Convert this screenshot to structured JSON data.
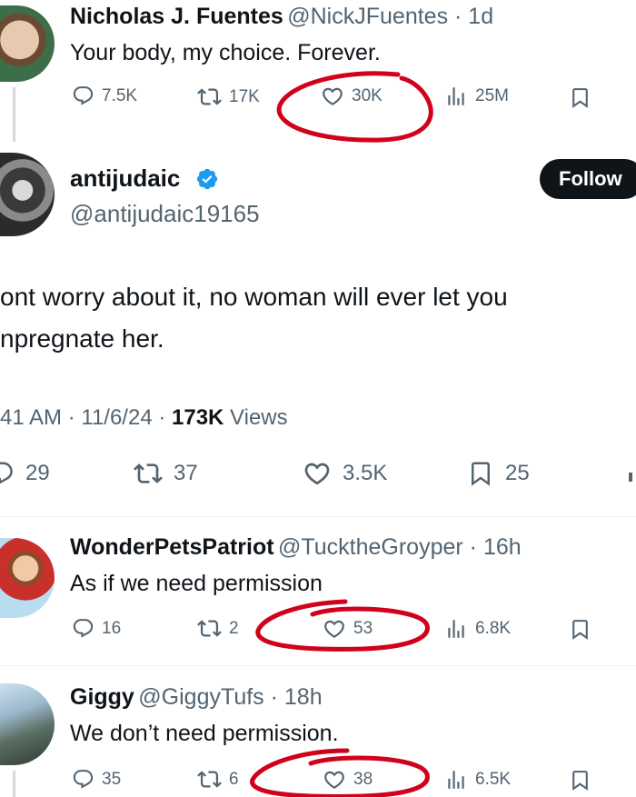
{
  "tweets": [
    {
      "name": "Nicholas J. Fuentes",
      "handle": "@NickJFuentes",
      "sep": " · ",
      "time": "1d",
      "text": "Your body, my choice. Forever.",
      "replies": "7.5K",
      "retweets": "17K",
      "likes": "30K",
      "views": "25M"
    }
  ],
  "main": {
    "name": "antijudaic",
    "handle": "@antijudaic19165",
    "follow_label": "Follow",
    "text_line1": "ont worry about it, no woman will ever let you",
    "text_line2": "npregnate her.",
    "meta_time": "41 AM",
    "sep": " · ",
    "date": "11/6/24",
    "views_count": "173K",
    "views_label": " Views",
    "replies": "29",
    "retweets": "37",
    "likes": "3.5K",
    "bookmarks": "25"
  },
  "replies": [
    {
      "name": "WonderPetsPatriot",
      "handle": "@TucktheGroyper",
      "sep": " · ",
      "time": "16h",
      "text": "As if we need permission",
      "replies": "16",
      "retweets": "2",
      "likes": "53",
      "views": "6.8K"
    },
    {
      "name": "Giggy",
      "handle": "@GiggyTufs",
      "sep": " · ",
      "time": "18h",
      "text": "We don’t need permission.",
      "replies": "35",
      "retweets": "6",
      "likes": "38",
      "views": "6.5K"
    }
  ],
  "colors": {
    "text": "#0f1419",
    "secondary": "#536471",
    "verified": "#1d9bf0",
    "annotation": "#d0021b",
    "button_bg": "#0f1419"
  },
  "icons": [
    "reply-icon",
    "retweet-icon",
    "like-icon",
    "views-icon",
    "bookmark-icon",
    "verified-badge-icon"
  ]
}
